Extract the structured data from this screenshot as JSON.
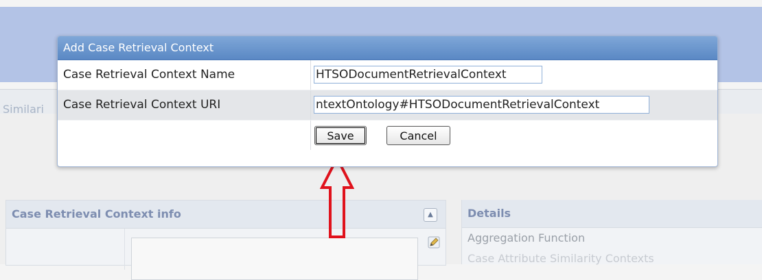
{
  "background": {
    "tab_label": "Similari"
  },
  "info_panel": {
    "title": "Case Retrieval Context info"
  },
  "details_panel": {
    "title": "Details",
    "items": [
      "Aggregation Function",
      "Case Attribute Similarity Contexts"
    ]
  },
  "dialog": {
    "title": "Add Case Retrieval Context",
    "fields": [
      {
        "label": "Case Retrieval Context Name",
        "value": "HTSODocumentRetrievalContext"
      },
      {
        "label": "Case Retrieval Context URI",
        "value": "ntextOntology#HTSODocumentRetrievalContext"
      }
    ],
    "save_label": "Save",
    "cancel_label": "Cancel"
  },
  "colors": {
    "header_band": "#b3c3e6",
    "dialog_title_bg": "#5a88c4",
    "annotation_arrow": "#e0121c"
  },
  "icons": [
    "collapse-up-icon",
    "edit-pencil-icon",
    "annotation-arrow-icon"
  ]
}
